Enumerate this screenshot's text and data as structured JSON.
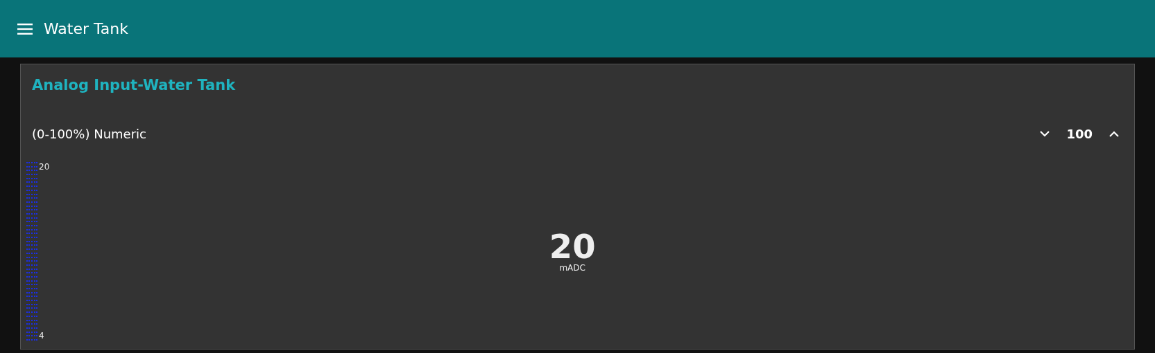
{
  "header": {
    "title": "Water Tank"
  },
  "card": {
    "title": "Analog Input-Water Tank",
    "numeric": {
      "label": "(0-100%) Numeric",
      "value": "100"
    },
    "gauge": {
      "max": "20",
      "min": "4",
      "level": 1,
      "value": "20",
      "unit": "mADC"
    }
  }
}
